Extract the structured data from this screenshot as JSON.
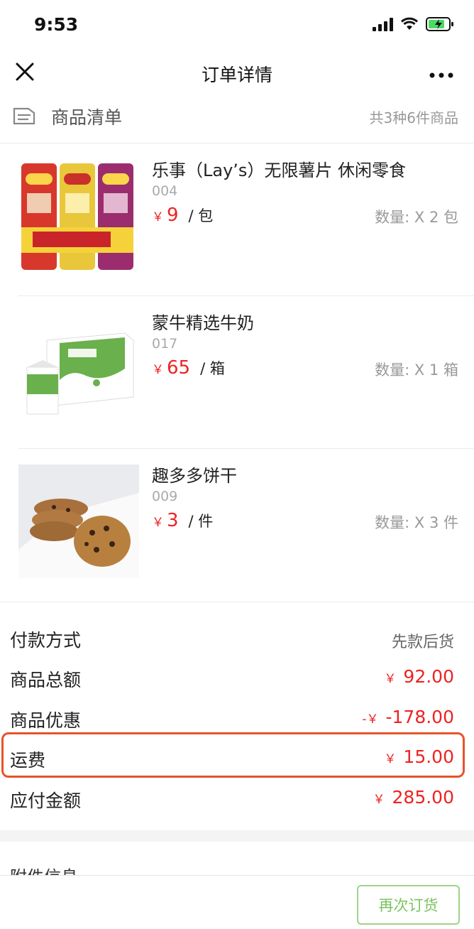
{
  "status_bar": {
    "time": "9:53"
  },
  "nav": {
    "title": "订单详情"
  },
  "items_section": {
    "title": "商品清单",
    "count": "共3种6件商品"
  },
  "products": [
    {
      "name": "乐事（Lay’s）无限薯片 休闲零食",
      "code": "004",
      "currency": "￥",
      "price": "9",
      "unit": "/ 包",
      "qty": "数量: X 2 包",
      "image": "chips-image"
    },
    {
      "name": "蒙牛精选牛奶",
      "code": "017",
      "currency": "￥",
      "price": "65",
      "unit": "/ 箱",
      "qty": "数量: X 1 箱",
      "image": "milk-image"
    },
    {
      "name": "趣多多饼干",
      "code": "009",
      "currency": "￥",
      "price": "3",
      "unit": "/ 件",
      "qty": "数量: X 3 件",
      "image": "cookie-image"
    }
  ],
  "summary": {
    "payment": {
      "label": "付款方式",
      "value": "先款后货"
    },
    "subtotal": {
      "label": "商品总额",
      "sym": "￥",
      "value": "92.00"
    },
    "discount": {
      "label": "商品优惠",
      "sym": "-￥",
      "value": "-178.00"
    },
    "shipping": {
      "label": "运费",
      "sym": "￥",
      "value": "15.00"
    },
    "total": {
      "label": "应付金额",
      "sym": "￥",
      "value": "285.00"
    }
  },
  "attachments": {
    "title": "附件信息"
  },
  "actions": {
    "reorder": "再次订货"
  },
  "colors": {
    "price": "#ee2222",
    "accent_green": "#7cc35e",
    "highlight": "#e8532a"
  }
}
